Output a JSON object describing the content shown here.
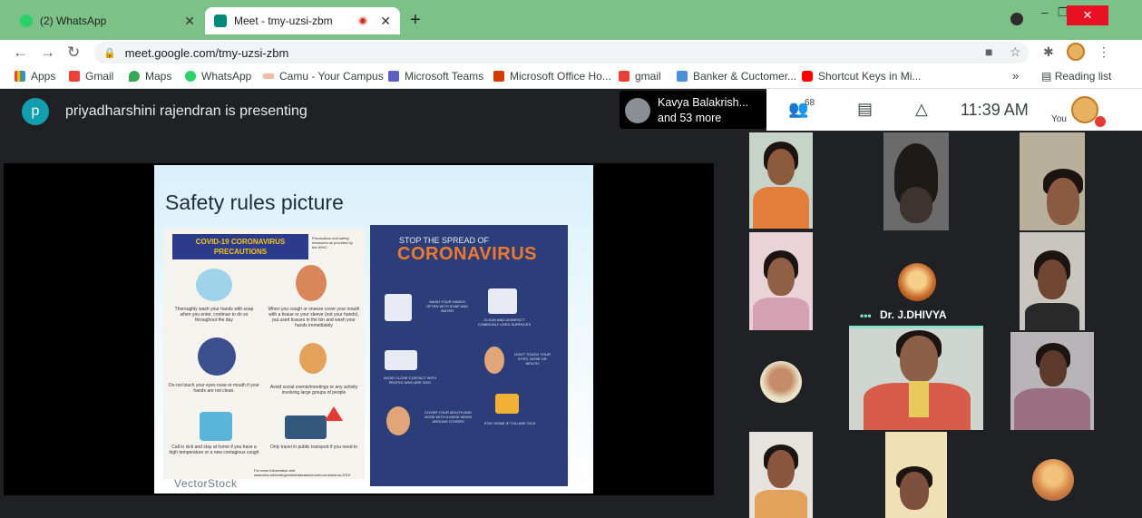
{
  "browser": {
    "tabs": [
      {
        "title": "(2) WhatsApp",
        "active": false
      },
      {
        "title": "Meet - tmy-uzsi-zbm",
        "active": true
      }
    ],
    "url": "meet.google.com/tmy-uzsi-zbm",
    "bookmarks": [
      "Apps",
      "Gmail",
      "Maps",
      "WhatsApp",
      "Camu - Your Campus",
      "Microsoft Teams",
      "Microsoft Office Ho...",
      "gmail",
      "Banker & Cuctomer...",
      "Shortcut Keys in Mi..."
    ],
    "reading_list": "Reading list",
    "bookmark_overflow": "»"
  },
  "meet": {
    "presenter_initial": "p",
    "presenter_text": "priyadharshini rajendran is presenting",
    "participant_name": "Kavya Balakrish...",
    "participant_more": "and 53 more",
    "people_count": "68",
    "time": "11:39  AM",
    "you_label": "You",
    "tile_name": "Dr. J.DHIVYA",
    "tile_dots": "•••"
  },
  "slide": {
    "title": "Safety rules picture",
    "left_poster": {
      "heading_line1": "COVID-19 CORONAVIRUS",
      "heading_line2": "PRECAUTIONS",
      "side_note": "Precautions and safety measures as provided by the WHO",
      "tips": [
        "Thoroughly wash your hands with soap when you enter, continue to do so throughout the day",
        "When you cough or sneeze cover your mouth with a tissue or your sleeve (not your hands), put used tissues in the bin and wash your hands immediately",
        "Do not touch your eyes nose or mouth if your hands are not clean.",
        "Avoid social events/meetings or any activity involving large groups of people",
        "Call in sick and stay at home if you have a high temperature or a new contagious cough",
        "Only travel in public transport if you need to"
      ],
      "footer": "For more information visit www.who.int/emergencies/diseases/novel-coronavirus-2019"
    },
    "right_poster": {
      "small": "STOP THE SPREAD OF",
      "big": "CORONAVIRUS",
      "tips": [
        "WASH YOUR HANDS OFTEN WITH SOAP AND WATER",
        "CLEAN AND DISINFECT COMMONLY USED SURFACES",
        "AVOID CLOSE CONTACT WITH PEOPLE WHO ARE SICK",
        "DON'T TOUCH YOUR EYES, NOSE OR MOUTH",
        "COVER YOUR MOUTH AND NOSE WITH A MASK WHEN AROUND OTHERS",
        "STAY HOME IF YOU ARE SICK"
      ]
    },
    "watermark": "VectorStock"
  },
  "colors": {
    "tabstrip": "#7cc187",
    "meet_bg": "#202124",
    "presenter_avatar": "#129eaf",
    "poster_navy": "#2c3e7a",
    "poster_orange": "#f07a2b",
    "close_red": "#e81123"
  },
  "icons": {
    "bookmark_apps": "apps-grid-icon",
    "people": "people-icon",
    "chat": "chat-icon",
    "activities": "activities-icon"
  }
}
